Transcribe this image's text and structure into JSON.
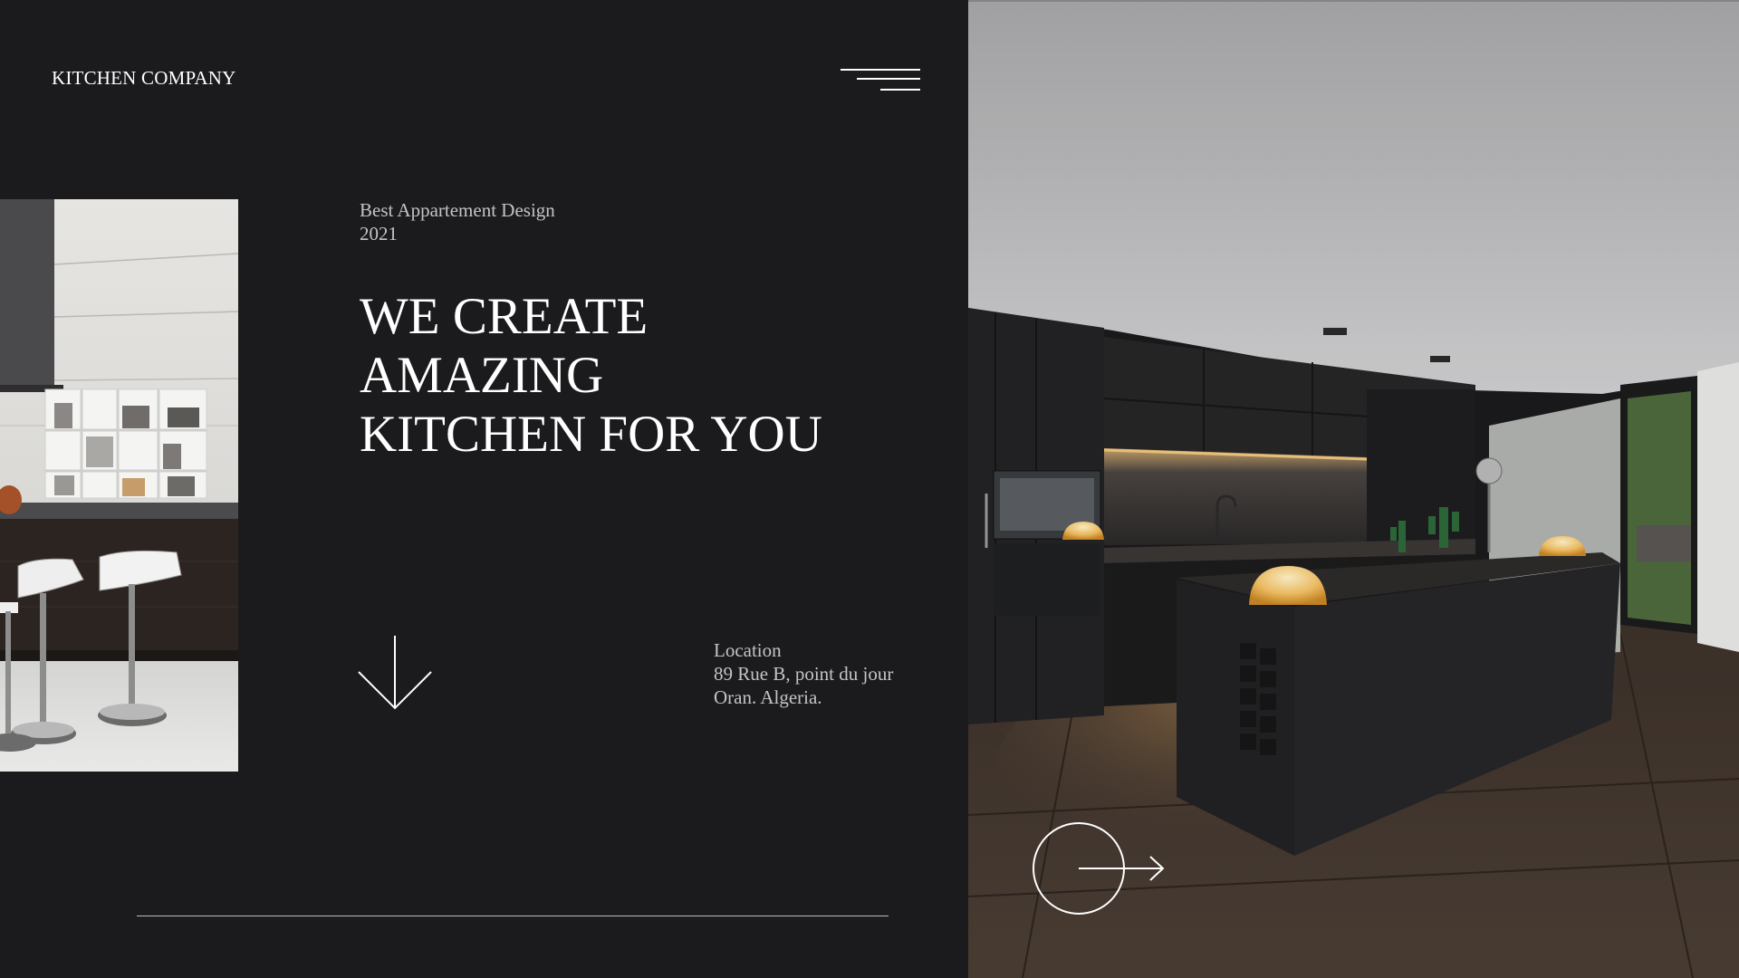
{
  "header": {
    "brand": "KITCHEN COMPANY"
  },
  "intro": {
    "subtitle_line1": "Best Appartement Design",
    "subtitle_line2": "2021"
  },
  "hero": {
    "headline_line1": "WE CREATE",
    "headline_line2": "AMAZING",
    "headline_line3": "KITCHEN FOR YOU"
  },
  "location": {
    "label": "Location",
    "address_line1": "89 Rue B, point du jour",
    "address_line2": "Oran. Algeria."
  },
  "icons": {
    "menu": "hamburger-menu-icon",
    "scroll_down": "arrow-down-icon",
    "next": "circle-arrow-right-icon"
  },
  "colors": {
    "background": "#1b1a1c",
    "text_primary": "#ffffff",
    "text_muted": "#c4c3c6"
  }
}
